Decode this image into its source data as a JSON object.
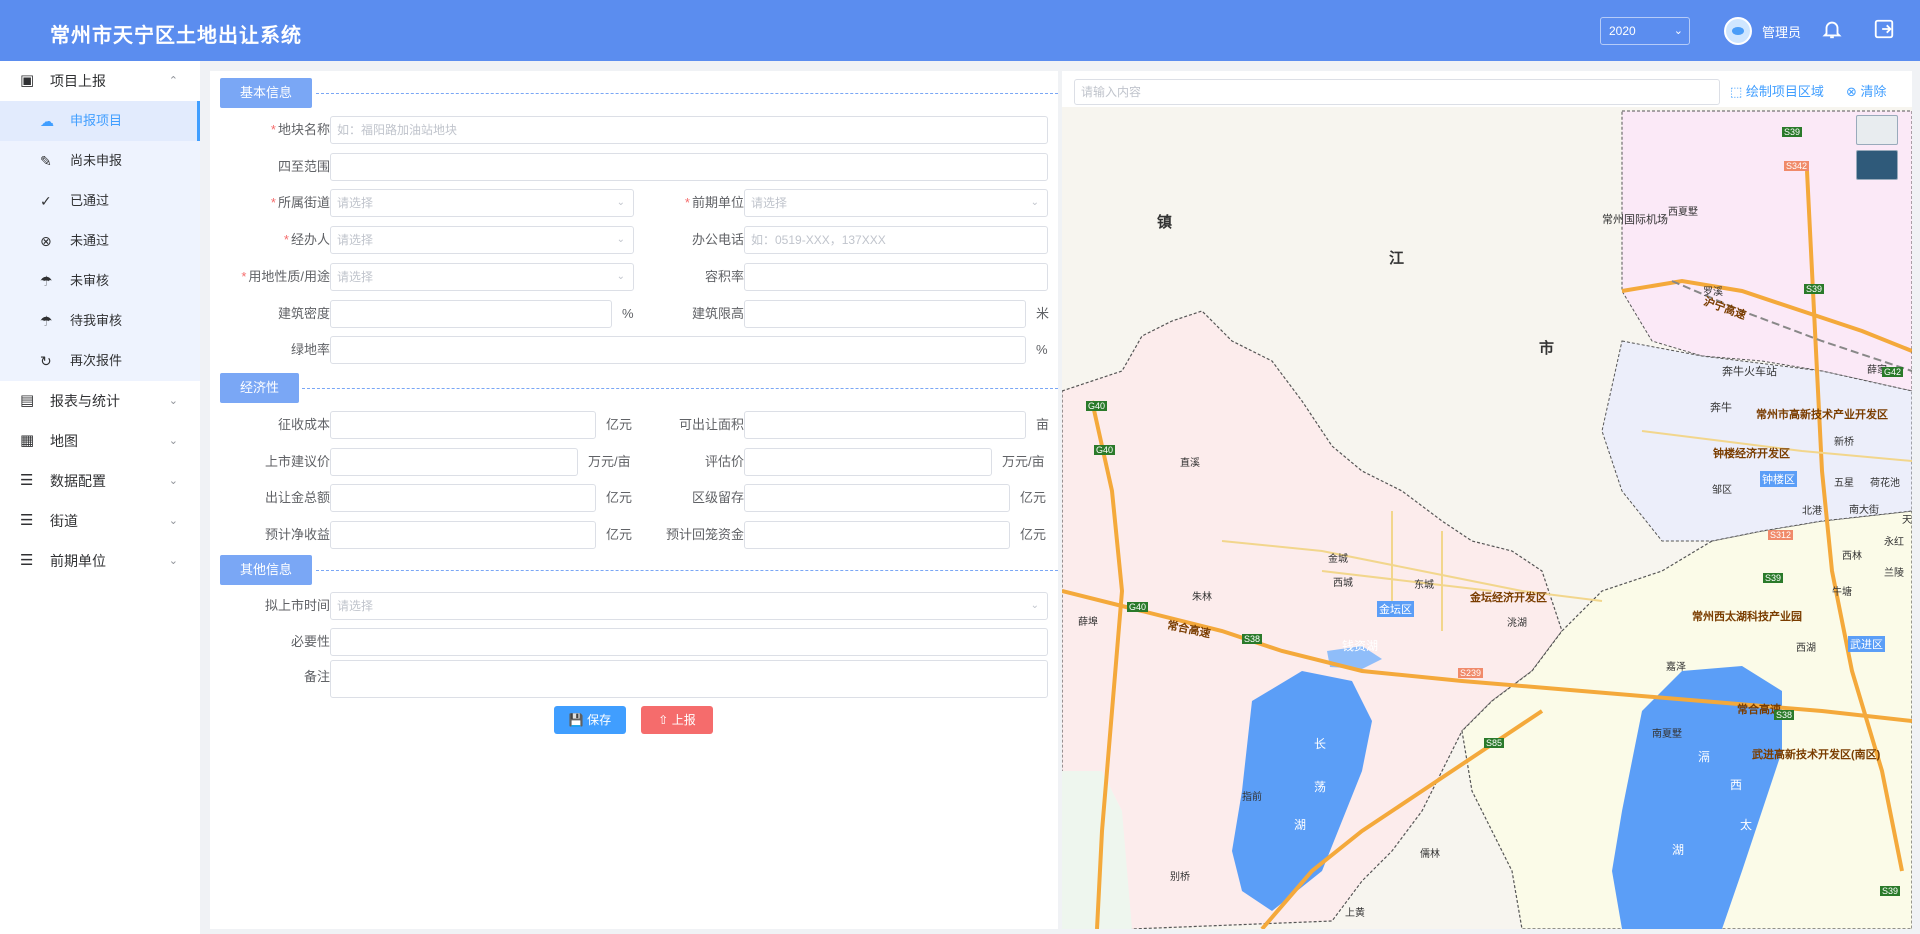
{
  "header": {
    "title": "常州市天宁区土地出让系统",
    "year": "2020",
    "username": "管理员"
  },
  "sidebar": {
    "groups": [
      {
        "label": "项目上报",
        "icon": "cube-icon",
        "expanded": true
      },
      {
        "label": "报表与统计",
        "icon": "chart-icon",
        "expanded": false
      },
      {
        "label": "地图",
        "icon": "map-icon",
        "expanded": false
      },
      {
        "label": "数据配置",
        "icon": "settings-list-icon",
        "expanded": false
      },
      {
        "label": "街道",
        "icon": "list-icon",
        "expanded": false
      },
      {
        "label": "前期单位",
        "icon": "list-icon",
        "expanded": false
      }
    ],
    "items": [
      {
        "label": "申报项目",
        "icon": "upload-cloud-icon",
        "active": true
      },
      {
        "label": "尚未申报",
        "icon": "edit-doc-icon"
      },
      {
        "label": "已通过",
        "icon": "check-circle-icon"
      },
      {
        "label": "未通过",
        "icon": "close-circle-icon"
      },
      {
        "label": "未审核",
        "icon": "shield-icon"
      },
      {
        "label": "待我审核",
        "icon": "shield-icon"
      },
      {
        "label": "再次报件",
        "icon": "refresh-icon"
      }
    ]
  },
  "form": {
    "sections": {
      "basic": "基本信息",
      "economic": "经济性",
      "other": "其他信息"
    },
    "fields": {
      "plot_name": {
        "label": "地块名称",
        "placeholder": "如：福阳路加油站地块"
      },
      "boundary": {
        "label": "四至范围",
        "placeholder": ""
      },
      "street": {
        "label": "所属街道",
        "placeholder": "请选择"
      },
      "pre_unit": {
        "label": "前期单位",
        "placeholder": "请选择"
      },
      "handler": {
        "label": "经办人",
        "placeholder": "请选择"
      },
      "phone": {
        "label": "办公电话",
        "placeholder": "如：0519-XXX，137XXX"
      },
      "land_use": {
        "label": "用地性质/用途",
        "placeholder": "请选择"
      },
      "plot_ratio": {
        "label": "容积率",
        "placeholder": ""
      },
      "density": {
        "label": "建筑密度",
        "unit": "%"
      },
      "height_limit": {
        "label": "建筑限高",
        "unit": "米"
      },
      "green_rate": {
        "label": "绿地率",
        "unit": "%"
      },
      "acq_cost": {
        "label": "征收成本",
        "unit": "亿元"
      },
      "transfer_area": {
        "label": "可出让面积",
        "unit": "亩"
      },
      "list_price": {
        "label": "上市建议价",
        "unit": "万元/亩"
      },
      "eval_price": {
        "label": "评估价",
        "unit": "万元/亩"
      },
      "total_amount": {
        "label": "出让金总额",
        "unit": "亿元"
      },
      "district_retain": {
        "label": "区级留存",
        "unit": "亿元"
      },
      "net_income": {
        "label": "预计净收益",
        "unit": "亿元"
      },
      "recovery": {
        "label": "预计回笼资金",
        "unit": "亿元"
      },
      "list_time": {
        "label": "拟上市时间",
        "placeholder": "请选择"
      },
      "necessity": {
        "label": "必要性",
        "placeholder": ""
      },
      "remark": {
        "label": "备注",
        "placeholder": ""
      }
    },
    "buttons": {
      "save": "保存",
      "submit": "上报"
    }
  },
  "map": {
    "search_placeholder": "请输入内容",
    "draw_label": "绘制项目区域",
    "clear_label": "清除",
    "labels": {
      "zhen": "镇",
      "jiang": "江",
      "shi": "市",
      "airport": "常州国际机场",
      "benniu": "奔牛火车站",
      "benniu_town": "奔牛",
      "gaoxin": "常州市高新技术产业开发区",
      "zhonglou_dev": "钟楼经济开发区",
      "zhonglou": "钟楼区",
      "jintan_dev": "金坛经济开发区",
      "jintan": "金坛区",
      "xitaihu": "常州西太湖科技产业园",
      "wujin_hi": "武进高新技术开发区(南区)",
      "wujin": "武进区",
      "qianzi": "钱资湖",
      "chang": "长",
      "dang": "荡",
      "hu1": "湖",
      "ge": "滆",
      "xi": "西",
      "tai": "太",
      "hu2": "湖",
      "huhuang": "沪宁高速",
      "changhe": "常合高速",
      "zhixi": "直溪",
      "zhulin": "朱林",
      "xuebu": "薛埠",
      "jincheng": "金城",
      "xicheng": "西城",
      "dongcheng": "东城",
      "rulin": "儒林",
      "zhitou": "指前",
      "bieqiao": "别桥",
      "shangxing": "上黄",
      "jiadian": "嘉泽",
      "niutang": "牛塘",
      "xuejia": "薛家",
      "xinqiao": "新桥",
      "xixiashu": "西夏墅",
      "luoxi": "罗溪",
      "zoupu": "邹区",
      "beigang": "北港",
      "nandajie": "南大街",
      "wuxing": "五星",
      "hehua": "荷花池",
      "xilin": "西林",
      "tianning": "天",
      "yonghong": "永红",
      "lanling": "兰陵",
      "xihu": "西湖",
      "nanxiashu": "南夏墅",
      "xiangmu": "洮湖"
    },
    "roads": [
      "G40",
      "G40",
      "G40",
      "S38",
      "S85",
      "S39",
      "S39",
      "S39",
      "S38",
      "S39",
      "G42",
      "S342",
      "S312",
      "S239"
    ]
  },
  "colors": {
    "header": "#5b8def",
    "accent": "#409eff",
    "save": "#409eff",
    "submit": "#f56c6c",
    "water": "#5b9ef7"
  }
}
